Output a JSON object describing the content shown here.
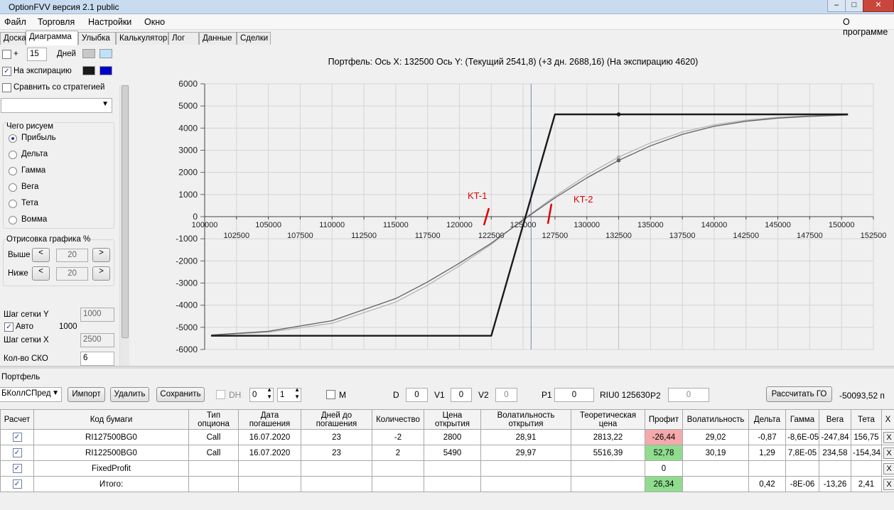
{
  "window": {
    "title": "OptionFVV версия 2.1 public",
    "minimize": "–",
    "maximize": "□",
    "close": "✕"
  },
  "menu": {
    "items": [
      "Файл",
      "Торговля",
      "Настройки",
      "Окно"
    ],
    "about": "О программе"
  },
  "tabs": [
    "Доска",
    "Диаграмма",
    "Улыбка",
    "Калькулятор",
    "Лог",
    "Данные",
    "Сделки"
  ],
  "left": {
    "plus_label": "+",
    "days_value": "15",
    "days_label": "Дней",
    "expiry_label": "На экспирацию",
    "compare_label": "Сравнить со стратегией",
    "draw_group_title": "Чего рисуем",
    "draw_options": [
      "Прибыль",
      "Дельта",
      "Гамма",
      "Вега",
      "Тета",
      "Вомма"
    ],
    "selected_option": "Прибыль",
    "render_group_title": "Отрисовка графика %",
    "above_label": "Выше",
    "above_value": "20",
    "below_label": "Ниже",
    "below_value": "20",
    "btn_left": "<",
    "btn_right": ">",
    "grid_y_label": "Шаг сетки Y",
    "grid_y_value": "1000",
    "auto_label": "Авто",
    "auto_value": "1000",
    "grid_x_label": "Шаг сетки X",
    "grid_x_value": "2500",
    "sko_label": "Кол-во СКО",
    "sko_value": "6",
    "colors": {
      "swatch_gray": "#c8c8c8",
      "swatch_lightblue": "#bfe2fb",
      "swatch_black": "#1a1a1a",
      "swatch_blue": "#0000c8"
    }
  },
  "chart": {
    "title": "Портфель: Ось X: 132500 Ось Y:  (Текущий 2541,8)  (+3 дн. 2688,16)  (На экспирацию 4620)",
    "annotation_1": "KT-1",
    "annotation_2": "KT-2"
  },
  "chart_data": {
    "type": "line",
    "y_ticks": [
      6000,
      5000,
      4000,
      3000,
      2000,
      1000,
      0,
      -1000,
      -2000,
      -3000,
      -4000,
      -5000,
      -6000
    ],
    "x_ticks_upper": [
      100000,
      105000,
      110000,
      115000,
      120000,
      125000,
      130000,
      135000,
      140000,
      145000,
      150000
    ],
    "x_ticks_lower": [
      102500,
      107500,
      112500,
      117500,
      122500,
      127500,
      132500,
      137500,
      142500,
      147500,
      152500
    ],
    "xlim": [
      100000,
      152500
    ],
    "ylim": [
      -6000,
      6000
    ],
    "grid": true,
    "crosshair_x": 125630,
    "marker_x": 132500,
    "series": [
      {
        "name": "На экспирацию",
        "color": "#1a1a1a",
        "x": [
          100500,
          122500,
          127500,
          150500
        ],
        "y": [
          -5380,
          -5380,
          4620,
          4620
        ],
        "marker": {
          "x": 132500,
          "y": 4620
        }
      },
      {
        "name": "Текущий",
        "color": "#606060",
        "x": [
          100500,
          105000,
          110000,
          115000,
          117500,
          120000,
          122500,
          125000,
          127500,
          130000,
          132500,
          135000,
          137500,
          140000,
          142500,
          145000,
          147500,
          150500
        ],
        "y": [
          -5350,
          -5180,
          -4700,
          -3700,
          -2950,
          -2100,
          -1200,
          -150,
          850,
          1750,
          2540,
          3200,
          3720,
          4080,
          4310,
          4450,
          4530,
          4590
        ],
        "marker": {
          "x": 132500,
          "y": 2541.8
        }
      },
      {
        "name": "+3 дн.",
        "color": "#b4b4b4",
        "x": [
          100500,
          105000,
          110000,
          115000,
          117500,
          120000,
          122500,
          125000,
          127500,
          130000,
          132500,
          135000,
          137500,
          140000,
          142500,
          145000,
          147500,
          150500
        ],
        "y": [
          -5360,
          -5220,
          -4820,
          -3860,
          -3100,
          -2220,
          -1250,
          -120,
          920,
          1880,
          2690,
          3330,
          3820,
          4150,
          4360,
          4490,
          4560,
          4600
        ],
        "marker": {
          "x": 132500,
          "y": 2688.16
        }
      }
    ]
  },
  "portfolio": {
    "group_label": "Портфель",
    "strategy_value": "БКоллСПред",
    "import_label": "Импорт",
    "delete_label": "Удалить",
    "save_label": "Сохранить",
    "dh_label": "DH",
    "dh_value1": "0",
    "dh_value2": "1",
    "m_label": "M",
    "d_label": "D",
    "d_value": "0",
    "v1_label": "V1",
    "v1_value": "0",
    "v2_label": "V2",
    "v2_value": "0",
    "p1_label": "P1",
    "p1_value": "0",
    "riu_label": "RIU0 125630",
    "p2_label": "P2",
    "p2_value": "0",
    "calc_go_label": "Рассчитать ГО",
    "go_value": "-50093,52 п"
  },
  "table": {
    "headers": [
      "Расчет",
      "Код бумаги",
      "Тип опциона",
      "Дата погашения",
      "Дней до погашения",
      "Количество",
      "Цена открытия",
      "Волатильность открытия",
      "Теоретическая цена",
      "Профит",
      "Волатильность",
      "Дельта",
      "Гамма",
      "Вега",
      "Тета",
      "X"
    ],
    "rows": [
      {
        "check": "✓",
        "code": "RI127500BG0",
        "type": "Call",
        "date": "16.07.2020",
        "days": "23",
        "qty": "-2",
        "price": "2800",
        "vol_open": "28,91",
        "theor": "2813,22",
        "profit": "-26,44",
        "profit_sign": "neg",
        "vol": "29,02",
        "delta": "-0,87",
        "gamma": "-8,6E-05",
        "vega": "-247,84",
        "theta": "156,75",
        "x": "X"
      },
      {
        "check": "✓",
        "code": "RI122500BG0",
        "type": "Call",
        "date": "16.07.2020",
        "days": "23",
        "qty": "2",
        "price": "5490",
        "vol_open": "29,97",
        "theor": "5516,39",
        "profit": "52,78",
        "profit_sign": "pos",
        "vol": "30,19",
        "delta": "1,29",
        "gamma": "7,8E-05",
        "vega": "234,58",
        "theta": "-154,34",
        "x": "X"
      },
      {
        "check": "✓",
        "code": "FixedProfit",
        "type": "",
        "date": "",
        "days": "",
        "qty": "",
        "price": "",
        "vol_open": "",
        "theor": "",
        "profit": "0",
        "profit_sign": "none",
        "vol": "",
        "delta": "",
        "gamma": "",
        "vega": "",
        "theta": "",
        "x": "X"
      },
      {
        "check": "✓",
        "code": "Итого:",
        "type": "",
        "date": "",
        "days": "",
        "qty": "",
        "price": "",
        "vol_open": "",
        "theor": "",
        "profit": "26,34",
        "profit_sign": "pos",
        "vol": "",
        "delta": "0,42",
        "gamma": "-8E-06",
        "vega": "-13,26",
        "theta": "2,41",
        "x": "X"
      }
    ]
  }
}
